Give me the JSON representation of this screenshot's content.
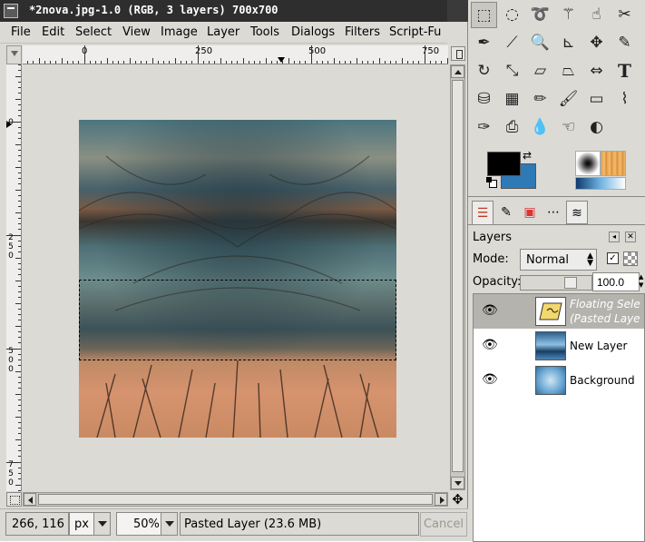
{
  "window": {
    "title": "*2nova.jpg-1.0 (RGB, 3 layers) 700x700"
  },
  "menu": [
    "File",
    "Edit",
    "Select",
    "View",
    "Image",
    "Layer",
    "Tools",
    "Dialogs",
    "Filters",
    "Script-Fu"
  ],
  "rulers": {
    "h_labels": [
      "0",
      "250",
      "500",
      "750"
    ],
    "v_labels": [
      "0",
      "250",
      "500",
      "750"
    ]
  },
  "status": {
    "coords": "266, 116",
    "unit": "px",
    "zoom": "50%",
    "message": "Pasted Layer (23.6 MB)",
    "cancel_label": "Cancel"
  },
  "toolbox": {
    "tools": [
      "rect-select",
      "ellipse-select",
      "free-select",
      "fuzzy-select",
      "color-select",
      "scissors",
      "paths",
      "color-picker",
      "zoom",
      "measure",
      "move",
      "crop",
      "rotate",
      "scale",
      "shear",
      "perspective",
      "flip",
      "text",
      "bucket-fill",
      "blend",
      "pencil",
      "paintbrush",
      "eraser",
      "airbrush",
      "ink",
      "clone",
      "convolve",
      "smudge",
      "dodge-burn"
    ],
    "colors": {
      "foreground": "#000000",
      "background": "#2d7ab7"
    }
  },
  "layers_panel": {
    "title": "Layers",
    "mode_label": "Mode:",
    "mode_value": "Normal",
    "opacity_label": "Opacity:",
    "opacity_value": "100.0",
    "opacity_fraction": 1.0,
    "layers": [
      {
        "name_line1": "Floating Sele",
        "name_line2": "(Pasted Laye",
        "selected": true
      },
      {
        "name_line1": "New Layer",
        "name_line2": "",
        "selected": false
      },
      {
        "name_line1": "Background",
        "name_line2": "",
        "selected": false
      }
    ]
  }
}
